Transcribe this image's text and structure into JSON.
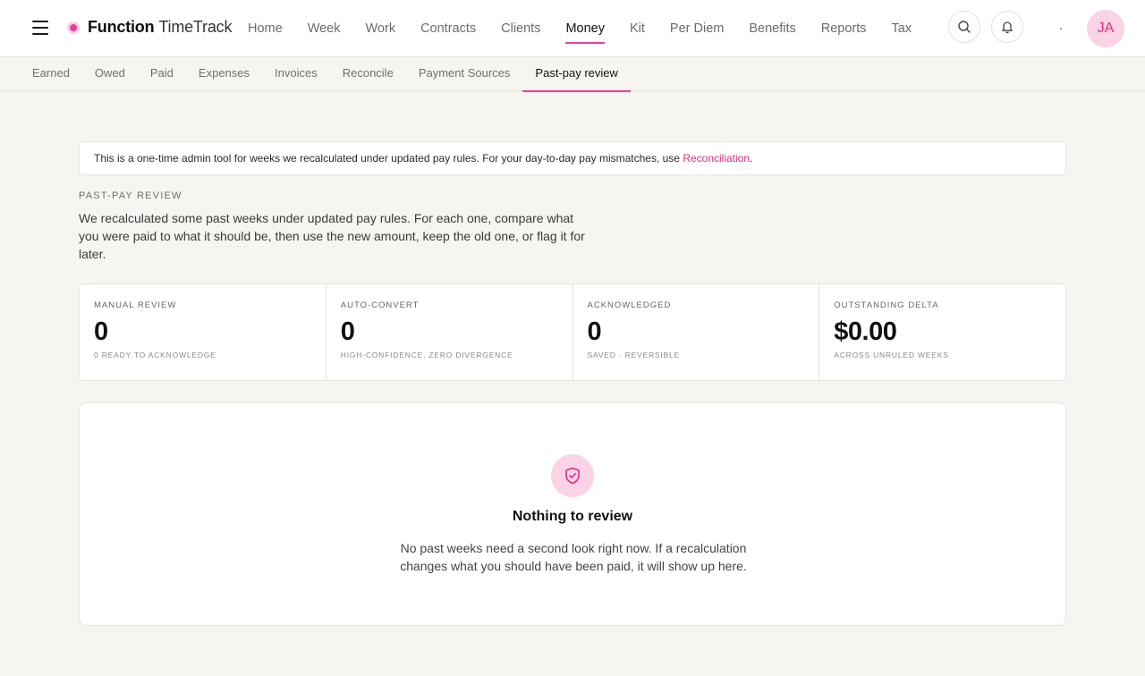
{
  "app": {
    "brand_bold": "Function",
    "brand_light": "TimeTrack",
    "accent": "#ee3f93"
  },
  "nav": {
    "items": [
      {
        "label": "Home"
      },
      {
        "label": "Week"
      },
      {
        "label": "Work"
      },
      {
        "label": "Contracts"
      },
      {
        "label": "Clients"
      },
      {
        "label": "Money"
      },
      {
        "label": "Kit"
      },
      {
        "label": "Per Diem"
      },
      {
        "label": "Benefits"
      },
      {
        "label": "Reports"
      },
      {
        "label": "Tax"
      }
    ],
    "active": "Money",
    "search_icon": "search-icon",
    "bell_icon": "bell-icon",
    "avatar_initials": "JA"
  },
  "subnav": {
    "tabs": [
      {
        "label": "Earned"
      },
      {
        "label": "Owed"
      },
      {
        "label": "Paid"
      },
      {
        "label": "Expenses"
      },
      {
        "label": "Invoices"
      },
      {
        "label": "Reconcile"
      },
      {
        "label": "Payment Sources"
      },
      {
        "label": "Past-pay review"
      }
    ],
    "active": "Past-pay review"
  },
  "notice": {
    "text": "This is a one-time admin tool for weeks we recalculated under updated pay rules. For your day-to-day pay mismatches, use ",
    "link": "Reconciliation",
    "suffix": "."
  },
  "section": {
    "eyebrow": "PAST-PAY REVIEW",
    "intro": "We recalculated some past weeks under updated pay rules. For each one, compare what you were paid to what it should be, then use the new amount, keep the old one, or flag it for later."
  },
  "stats": [
    {
      "label": "MANUAL REVIEW",
      "value": "0",
      "sub": "0 READY TO ACKNOWLEDGE"
    },
    {
      "label": "AUTO-CONVERT",
      "value": "0",
      "sub": "HIGH-CONFIDENCE, ZERO DIVERGENCE"
    },
    {
      "label": "ACKNOWLEDGED",
      "value": "0",
      "sub": "SAVED · REVERSIBLE"
    },
    {
      "label": "OUTSTANDING DELTA",
      "value": "$0.00",
      "sub": "ACROSS UNRULED WEEKS"
    }
  ],
  "empty": {
    "icon": "shield-check-icon",
    "title": "Nothing to review",
    "description": "No past weeks need a second look right now. If a recalculation changes what you should have been paid, it will show up here."
  }
}
